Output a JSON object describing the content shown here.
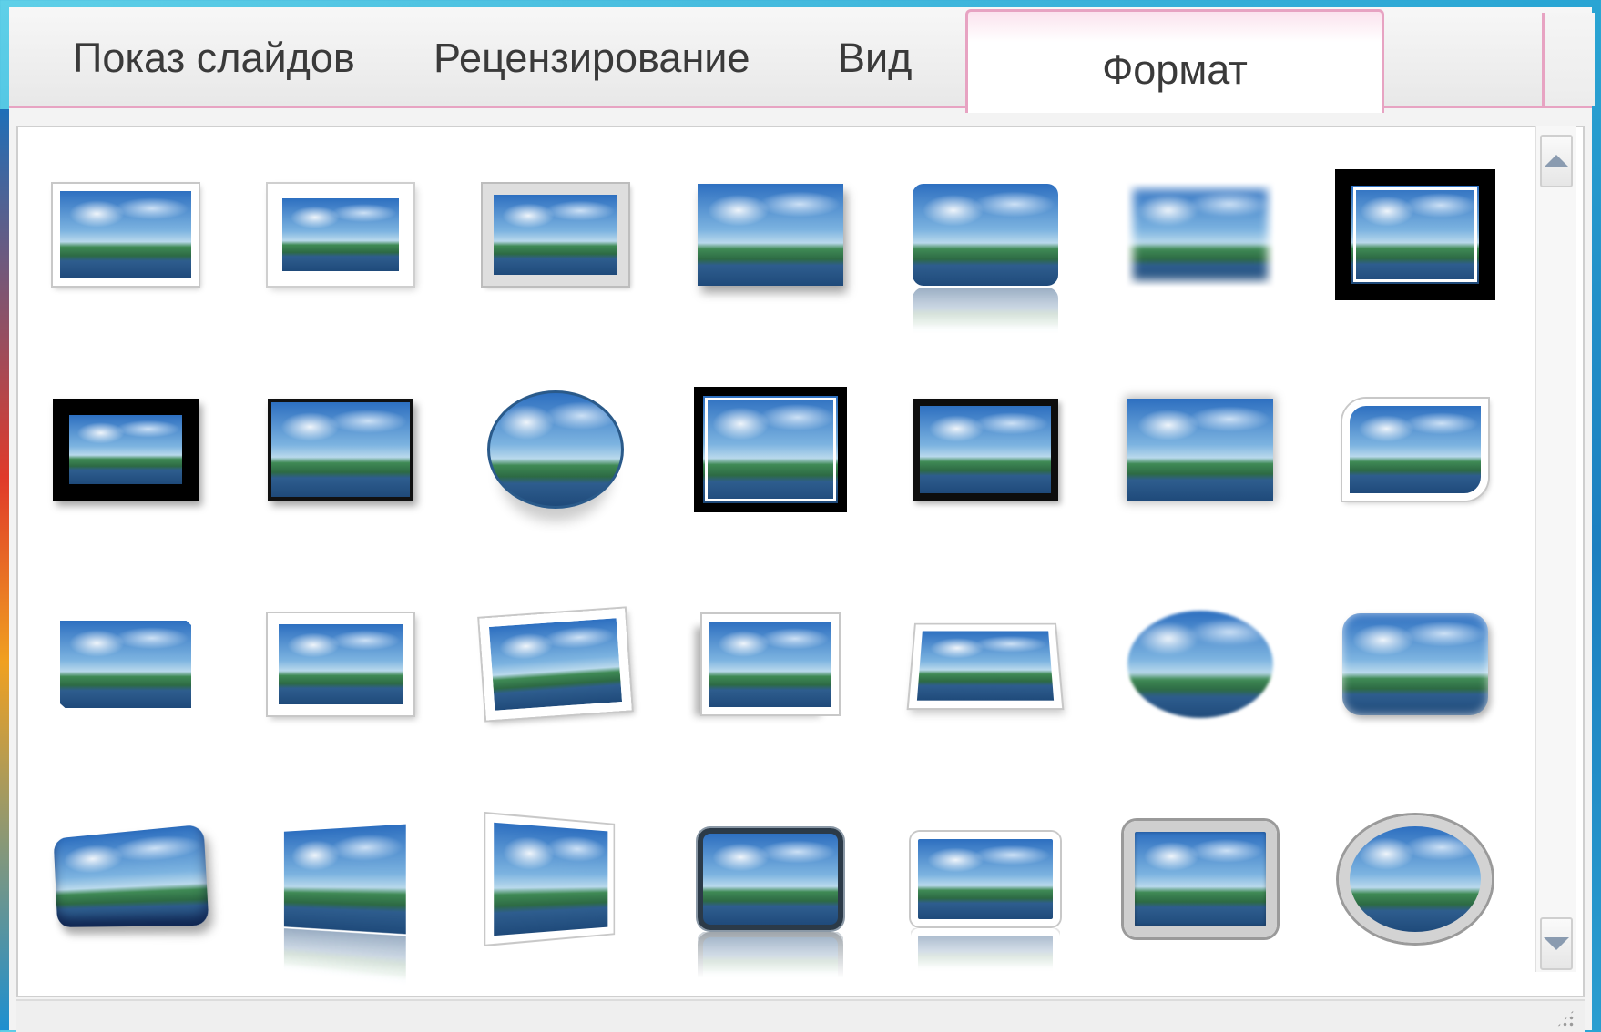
{
  "tabs": [
    {
      "label": "Показ слайдов",
      "active": false
    },
    {
      "label": "Рецензирование",
      "active": false
    },
    {
      "label": "Вид",
      "active": false
    },
    {
      "label": "Формат",
      "active": true
    }
  ],
  "gallery": {
    "rows": 4,
    "columns": 7,
    "items": [
      "simple-frame-white",
      "soft-edge-rectangle",
      "beveled-matte-white",
      "drop-shadow-rectangle",
      "reflected-rounded-rectangle",
      "soft-edge-blurred",
      "double-frame-black",
      "thick-matte-black",
      "simple-frame-black",
      "reflected-oval",
      "compound-frame-black",
      "metal-frame",
      "center-shadow-rectangle",
      "rounded-diagonal-corner-white",
      "snip-diagonal-corner-white",
      "moderate-frame-white",
      "rotated-white",
      "perspective-shadow-white",
      "relaxed-perspective-white",
      "soft-edge-oval",
      "bevel-rectangle",
      "bevel-perspective",
      "reflected-perspective-right",
      "perspective-left-white",
      "metal-rounded-rectangle",
      "reflected-bevel-white",
      "beveled-oval-black",
      "metal-oval"
    ]
  },
  "colors": {
    "tab_accent": "#e7a3c2",
    "background": "#2aa6d4"
  },
  "icons": {
    "scroll_up": "triangle-up-icon",
    "scroll_down": "triangle-down-icon",
    "resize": "resize-grip-icon"
  }
}
